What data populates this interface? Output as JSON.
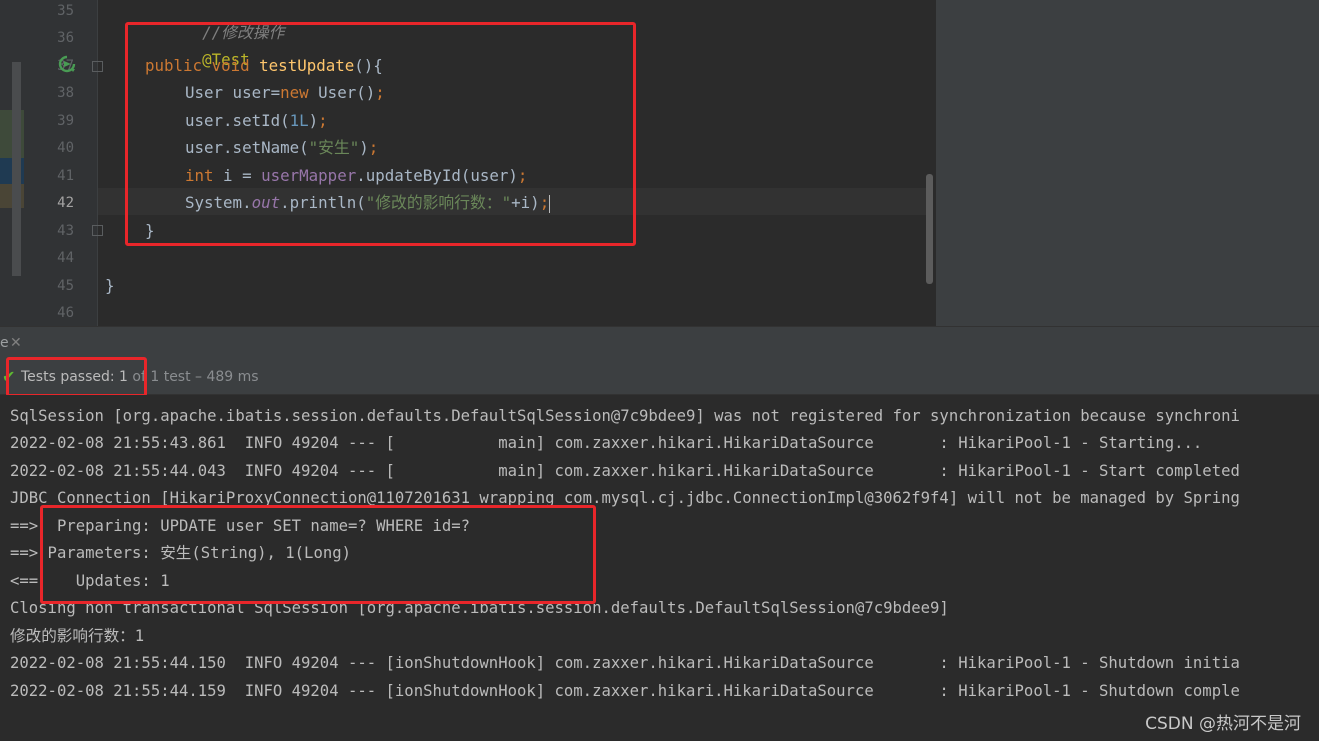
{
  "editor": {
    "line_numbers": [
      "35",
      "36",
      "37",
      "38",
      "39",
      "40",
      "41",
      "42",
      "43",
      "44",
      "45",
      "46"
    ],
    "current_line": "42",
    "code": {
      "l35_comment": "//修改操作",
      "l36_annotation": "@Test",
      "l37_public": "public",
      "l37_void": "void",
      "l37_method": "testUpdate",
      "l37_rest": "(){",
      "l38_a": "User user=",
      "l38_new": "new",
      "l38_b": " User()",
      "l38_semi": ";",
      "l39_a": "user.setId(",
      "l39_num": "1L",
      "l39_b": ")",
      "l39_semi": ";",
      "l40_a": "user.setName(",
      "l40_str": "\"安生\"",
      "l40_b": ")",
      "l40_semi": ";",
      "l41_int": "int",
      "l41_a": " i = ",
      "l41_field": "userMapper",
      "l41_b": ".updateById(user)",
      "l41_semi": ";",
      "l42_a": "System.",
      "l42_out": "out",
      "l42_b": ".println(",
      "l42_str": "\"修改的影响行数：\"",
      "l42_c": "+i)",
      "l42_semi": ";",
      "l43_close": "}",
      "l45_close": "}"
    }
  },
  "run_panel": {
    "tab_mark": "e",
    "status_passed": "Tests passed: 1",
    "status_detail": " of 1 test – 489 ms"
  },
  "console": {
    "lines": [
      "SqlSession [org.apache.ibatis.session.defaults.DefaultSqlSession@7c9bdee9] was not registered for synchronization because synchroni",
      "2022-02-08 21:55:43.861  INFO 49204 --- [           main] com.zaxxer.hikari.HikariDataSource       : HikariPool-1 - Starting...",
      "2022-02-08 21:55:44.043  INFO 49204 --- [           main] com.zaxxer.hikari.HikariDataSource       : HikariPool-1 - Start completed",
      "JDBC Connection [HikariProxyConnection@1107201631 wrapping com.mysql.cj.jdbc.ConnectionImpl@3062f9f4] will not be managed by Spring",
      "==>  Preparing: UPDATE user SET name=? WHERE id=?",
      "==> Parameters: 安生(String), 1(Long)",
      "<==    Updates: 1",
      "Closing non transactional SqlSession [org.apache.ibatis.session.defaults.DefaultSqlSession@7c9bdee9]",
      "修改的影响行数：1",
      "2022-02-08 21:55:44.150  INFO 49204 --- [ionShutdownHook] com.zaxxer.hikari.HikariDataSource       : HikariPool-1 - Shutdown initia",
      "2022-02-08 21:55:44.159  INFO 49204 --- [ionShutdownHook] com.zaxxer.hikari.HikariDataSource       : HikariPool-1 - Shutdown comple"
    ]
  },
  "watermark": "CSDN @热河不是河",
  "colors": {
    "editor_bg": "#2b2b2b",
    "gutter_bg": "#313335",
    "highlight_box": "#e8262a",
    "pass_green": "#5fb832"
  }
}
